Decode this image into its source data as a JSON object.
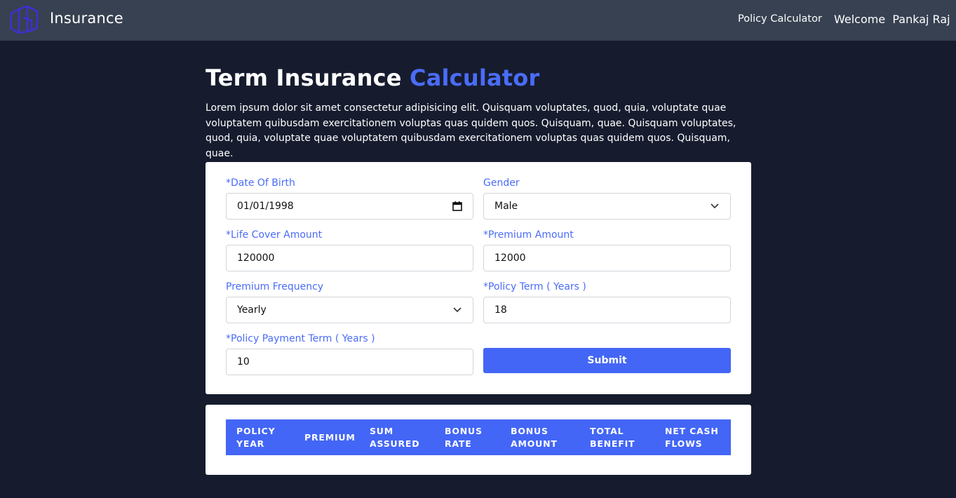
{
  "header": {
    "brand": "Insurance",
    "nav_link": "Policy Calculator",
    "welcome": "Welcome  Pankaj Raj"
  },
  "page": {
    "title_main": "Term Insurance ",
    "title_accent": "Calculator",
    "intro": "Lorem ipsum dolor sit amet consectetur adipisicing elit. Quisquam voluptates, quod, quia, voluptate quae voluptatem quibusdam exercitationem voluptas quas quidem quos. Quisquam, quae. Quisquam voluptates, quod, quia, voluptate quae voluptatem quibusdam exercitationem voluptas quas quidem quos. Quisquam, quae."
  },
  "form": {
    "dob": {
      "label": "*Date Of Birth",
      "value": "01/01/1998",
      "icon": "calendar-icon"
    },
    "gender": {
      "label": "Gender",
      "value": "Male",
      "icon": "chevron-down-icon"
    },
    "life_cover": {
      "label": "*Life Cover Amount",
      "value": "120000"
    },
    "premium_amount": {
      "label": "*Premium Amount",
      "value": "12000"
    },
    "premium_frequency": {
      "label": "Premium Frequency",
      "value": "Yearly",
      "icon": "chevron-down-icon"
    },
    "policy_term": {
      "label": "*Policy Term ( Years )",
      "value": "18"
    },
    "payment_term": {
      "label": "*Policy Payment Term ( Years )",
      "value": "10"
    },
    "submit_label": "Submit"
  },
  "table": {
    "columns": [
      [
        "POLICY",
        "YEAR"
      ],
      [
        "PREMIUM",
        ""
      ],
      [
        "SUM",
        "ASSURED"
      ],
      [
        "BONUS",
        "RATE"
      ],
      [
        "BONUS",
        "AMOUNT"
      ],
      [
        "TOTAL",
        "BENEFIT"
      ],
      [
        "NET CASH",
        "FLOWS"
      ]
    ]
  },
  "colors": {
    "accent": "#4a6cf7",
    "button": "#4366f6",
    "header_bg": "#374151",
    "page_bg": "#161c2e"
  }
}
